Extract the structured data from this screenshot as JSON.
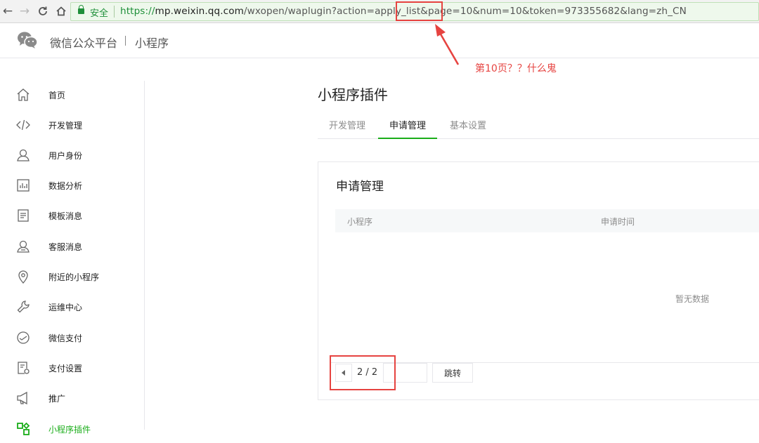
{
  "browser": {
    "secure_label": "安全",
    "url_proto": "https://",
    "url_host": "mp.weixin.qq.com",
    "url_rest": "/wxopen/waplugin?action=apply_list&page=10&num=10&token=973355682&lang=zh_CN"
  },
  "header": {
    "platform_name": "微信公众平台",
    "platform_sub": "小程序"
  },
  "sidebar": {
    "items": [
      {
        "label": "首页",
        "icon": "home-icon"
      },
      {
        "label": "开发管理",
        "icon": "code-icon"
      },
      {
        "label": "用户身份",
        "icon": "user-icon"
      },
      {
        "label": "数据分析",
        "icon": "chart-icon"
      },
      {
        "label": "模板消息",
        "icon": "document-icon"
      },
      {
        "label": "客服消息",
        "icon": "customer-service-icon"
      },
      {
        "label": "附近的小程序",
        "icon": "location-icon"
      },
      {
        "label": "运维中心",
        "icon": "wrench-icon"
      },
      {
        "label": "微信支付",
        "icon": "payment-icon"
      },
      {
        "label": "支付设置",
        "icon": "payment-settings-icon"
      },
      {
        "label": "推广",
        "icon": "megaphone-icon"
      },
      {
        "label": "小程序插件",
        "icon": "plugin-icon"
      }
    ],
    "active_color": "#1aad19"
  },
  "main": {
    "title": "小程序插件",
    "tabs": [
      {
        "label": "开发管理"
      },
      {
        "label": "申请管理"
      },
      {
        "label": "基本设置"
      }
    ],
    "active_tab": "申请管理",
    "panel": {
      "title": "申请管理",
      "columns": [
        "小程序",
        "申请时间"
      ],
      "empty_text": "暂无数据",
      "pager": {
        "page_display": "2 / 2",
        "input_value": "",
        "go_label": "跳转"
      }
    }
  },
  "annotation": {
    "comment": "第10页？？什么鬼",
    "color": "#e64340"
  }
}
